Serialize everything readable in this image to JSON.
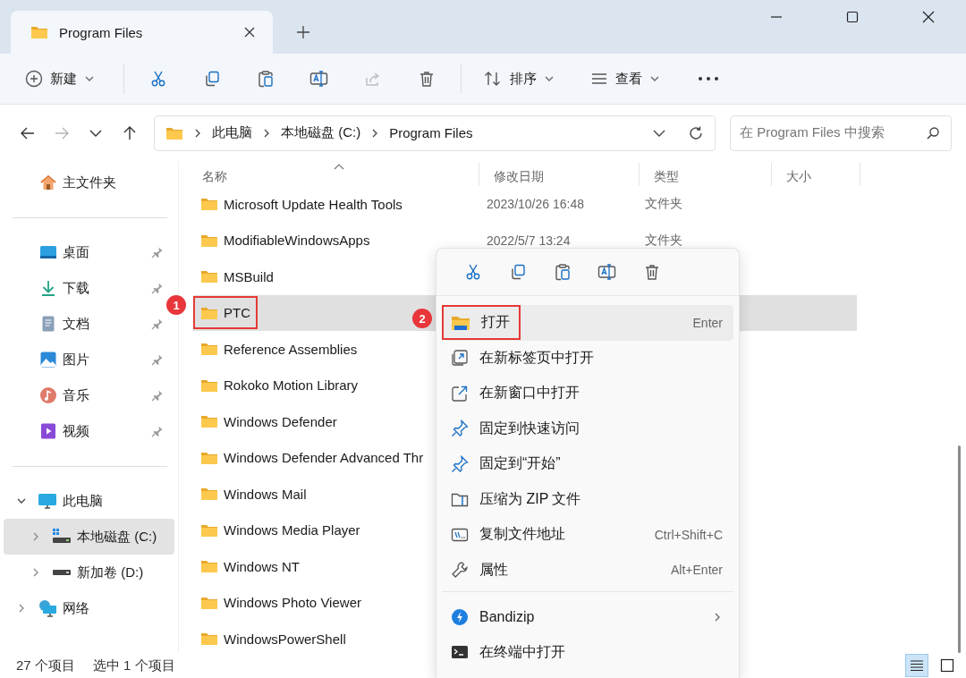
{
  "window": {
    "tab_title": "Program Files",
    "controls": [
      {
        "kind": "minimize"
      },
      {
        "kind": "maximize"
      },
      {
        "kind": "close"
      }
    ]
  },
  "toolbar": [
    {
      "kind": "new",
      "label": "新建",
      "dropdown": true,
      "disabled": false
    },
    {
      "kind": "cut",
      "dropdown": false,
      "disabled": false
    },
    {
      "kind": "copy",
      "dropdown": false,
      "disabled": false
    },
    {
      "kind": "paste",
      "dropdown": false,
      "disabled": false
    },
    {
      "kind": "rename",
      "dropdown": false,
      "disabled": false
    },
    {
      "kind": "share",
      "dropdown": false,
      "disabled": true
    },
    {
      "kind": "delete",
      "dropdown": false,
      "disabled": false
    },
    {
      "kind": "sort",
      "label": "排序",
      "dropdown": true,
      "disabled": false
    },
    {
      "kind": "view",
      "label": "查看",
      "dropdown": true,
      "disabled": false
    },
    {
      "kind": "more",
      "dropdown": false,
      "disabled": false
    }
  ],
  "address_bar": {
    "nav": [
      {
        "kind": "back",
        "disabled": false
      },
      {
        "kind": "forward",
        "disabled": true
      },
      {
        "kind": "recent",
        "disabled": false
      },
      {
        "kind": "up",
        "disabled": false
      }
    ],
    "breadcrumbs": [
      "此电脑",
      "本地磁盘 (C:)",
      "Program Files"
    ],
    "search": {
      "placeholder": "在 Program Files 中搜索"
    }
  },
  "sidebar": {
    "sections": [
      [
        {
          "label": "主文件夹",
          "kind": "home",
          "pinned": false
        }
      ],
      [
        {
          "label": "桌面",
          "kind": "desktop",
          "pinned": true
        },
        {
          "label": "下载",
          "kind": "download",
          "pinned": true
        },
        {
          "label": "文档",
          "kind": "document",
          "pinned": true
        },
        {
          "label": "图片",
          "kind": "pictures",
          "pinned": true
        },
        {
          "label": "音乐",
          "kind": "music",
          "pinned": true
        },
        {
          "label": "视频",
          "kind": "video",
          "pinned": true
        }
      ],
      [
        {
          "label": "此电脑",
          "kind": "pc",
          "expanded": true,
          "selected": false,
          "children": [
            {
              "label": "本地磁盘 (C:)",
              "kind": "system-drive",
              "expanded": false,
              "selected": true
            },
            {
              "label": "新加卷 (D:)",
              "kind": "drive",
              "expanded": false,
              "selected": false
            }
          ]
        },
        {
          "label": "网络",
          "kind": "network",
          "expanded": false,
          "selected": false
        }
      ]
    ]
  },
  "table": {
    "columns": [
      {
        "label": "名称",
        "sorted": true
      },
      {
        "label": "修改日期",
        "sorted": false
      },
      {
        "label": "类型",
        "sorted": false
      },
      {
        "label": "大小",
        "sorted": false
      }
    ],
    "rows": [
      {
        "name": "Microsoft Update Health Tools",
        "date": "2023/10/26 16:48",
        "type": "文件夹",
        "selected": false,
        "outlined": false
      },
      {
        "name": "ModifiableWindowsApps",
        "date": "2022/5/7 13:24",
        "type": "文件夹",
        "selected": false,
        "outlined": false
      },
      {
        "name": "MSBuild",
        "selected": false,
        "outlined": false
      },
      {
        "name": "PTC",
        "selected": true,
        "outlined": true
      },
      {
        "name": "Reference Assemblies",
        "selected": false,
        "outlined": false
      },
      {
        "name": "Rokoko Motion Library",
        "selected": false,
        "outlined": false
      },
      {
        "name": "Windows Defender",
        "selected": false,
        "outlined": false
      },
      {
        "name": "Windows Defender Advanced Thr",
        "selected": false,
        "outlined": false
      },
      {
        "name": "Windows Mail",
        "selected": false,
        "outlined": false
      },
      {
        "name": "Windows Media Player",
        "selected": false,
        "outlined": false
      },
      {
        "name": "Windows NT",
        "selected": false,
        "outlined": false
      },
      {
        "name": "Windows Photo Viewer",
        "selected": false,
        "outlined": false
      },
      {
        "name": "WindowsPowerShell",
        "selected": false,
        "outlined": false
      }
    ]
  },
  "context_menu": {
    "quick_actions": [
      {
        "kind": "cut"
      },
      {
        "kind": "copy"
      },
      {
        "kind": "paste"
      },
      {
        "kind": "rename"
      },
      {
        "kind": "delete"
      }
    ],
    "groups": [
      [
        {
          "kind": "open",
          "label": "打开",
          "shortcut": "Enter",
          "highlighted": true,
          "outlined": true,
          "submenu": false
        },
        {
          "kind": "open-tab",
          "label": "在新标签页中打开",
          "highlighted": false,
          "outlined": false,
          "submenu": false
        },
        {
          "kind": "open-window",
          "label": "在新窗口中打开",
          "highlighted": false,
          "outlined": false,
          "submenu": false
        },
        {
          "kind": "pin",
          "label": "固定到快速访问",
          "highlighted": false,
          "outlined": false,
          "submenu": false
        },
        {
          "kind": "pin",
          "label": "固定到“开始”",
          "highlighted": false,
          "outlined": false,
          "submenu": false
        },
        {
          "kind": "zip",
          "label": "压缩为 ZIP 文件",
          "highlighted": false,
          "outlined": false,
          "submenu": false
        },
        {
          "kind": "copy-path",
          "label": "复制文件地址",
          "shortcut": "Ctrl+Shift+C",
          "highlighted": false,
          "outlined": false,
          "submenu": false
        },
        {
          "kind": "properties",
          "label": "属性",
          "shortcut": "Alt+Enter",
          "highlighted": false,
          "outlined": false,
          "submenu": false
        }
      ],
      [
        {
          "kind": "bandizip",
          "label": "Bandizip",
          "highlighted": false,
          "outlined": false,
          "submenu": true
        },
        {
          "kind": "terminal",
          "label": "在终端中打开",
          "highlighted": false,
          "outlined": false,
          "submenu": false
        }
      ]
    ]
  },
  "step_badges": [
    "1",
    "2"
  ],
  "status_bar": {
    "item_count": "27 个项目",
    "selection": "选中 1 个项目",
    "views": [
      {
        "kind": "details",
        "selected": true
      },
      {
        "kind": "tiles",
        "selected": false
      }
    ]
  }
}
